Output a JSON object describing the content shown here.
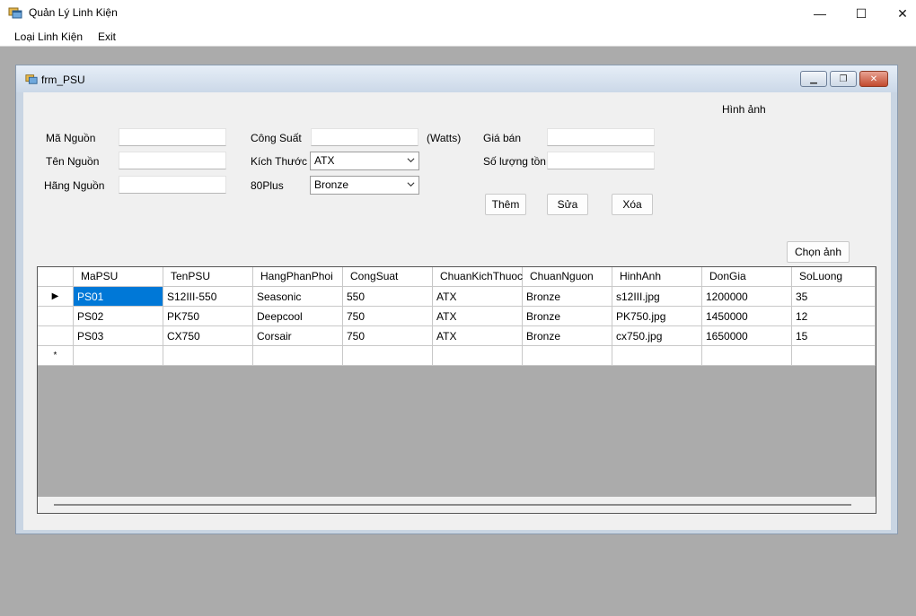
{
  "window": {
    "title": "Quản Lý Linh Kiện",
    "minimize": "—",
    "maximize": "☐",
    "close": "✕"
  },
  "menu": {
    "items": [
      "Loại Linh Kiện",
      "Exit"
    ]
  },
  "child": {
    "title": "frm_PSU",
    "minimize": "▁",
    "restore": "❐",
    "close": "✕"
  },
  "form": {
    "ma_nguon_label": "Mã Nguồn",
    "ten_nguon_label": "Tên Nguồn",
    "hang_nguon_label": "Hãng Nguồn",
    "cong_suat_label": "Công Suất",
    "watts_label": "(Watts)",
    "kich_thuoc_label": "Kích Thước",
    "kich_thuoc_value": "ATX",
    "plus80_label": "80Plus",
    "plus80_value": "Bronze",
    "gia_ban_label": "Giá bán",
    "so_luong_label": "Số lượng tồn",
    "hinh_anh_label": "Hình ảnh",
    "them_button": "Thêm",
    "sua_button": "Sửa",
    "xoa_button": "Xóa",
    "chon_anh_button": "Chọn ảnh"
  },
  "grid": {
    "columns": [
      "MaPSU",
      "TenPSU",
      "HangPhanPhoi",
      "CongSuat",
      "ChuanKichThuoc",
      "ChuanNguon",
      "HinhAnh",
      "DonGia",
      "SoLuong"
    ],
    "rows": [
      [
        "PS01",
        "S12III-550",
        "Seasonic",
        "550",
        "ATX",
        "Bronze",
        "s12III.jpg",
        "1200000",
        "35"
      ],
      [
        "PS02",
        "PK750",
        "Deepcool",
        "750",
        "ATX",
        "Bronze",
        "PK750.jpg",
        "1450000",
        "12"
      ],
      [
        "PS03",
        "CX750",
        "Corsair",
        "750",
        "ATX",
        "Bronze",
        "cx750.jpg",
        "1650000",
        "15"
      ]
    ],
    "current_row_marker": "▶",
    "new_row_marker": "*"
  },
  "colors": {
    "selection": "#0078d7",
    "mdi_background": "#ababab"
  }
}
